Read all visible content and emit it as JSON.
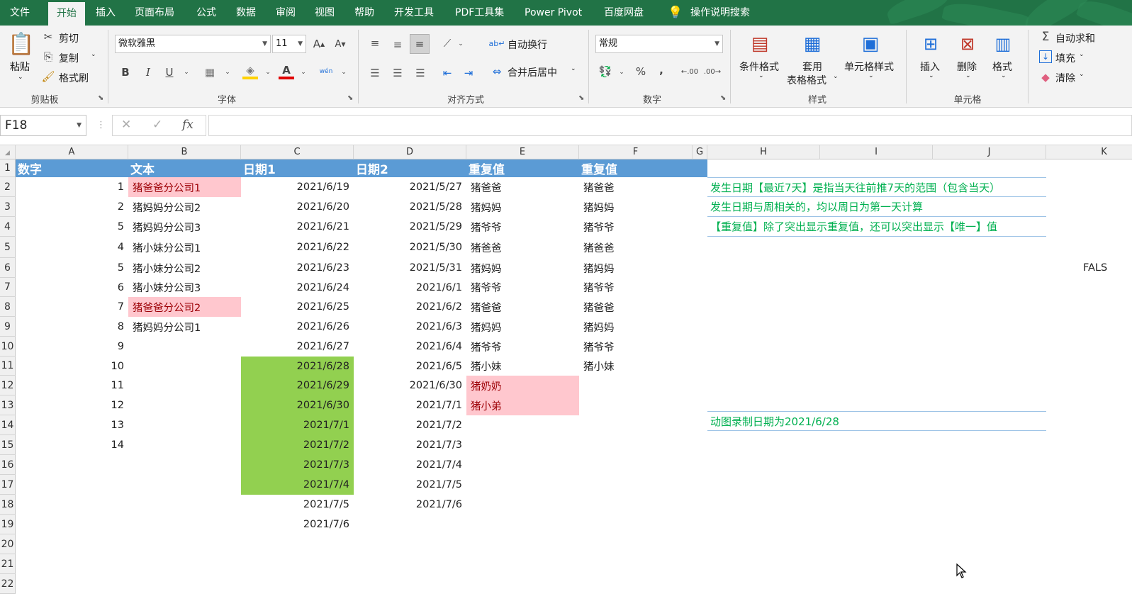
{
  "tabs": [
    "文件",
    "开始",
    "插入",
    "页面布局",
    "公式",
    "数据",
    "审阅",
    "视图",
    "帮助",
    "开发工具",
    "PDF工具集",
    "Power Pivot",
    "百度网盘",
    "操作说明搜索"
  ],
  "ribbon": {
    "clipboard": {
      "paste": "粘贴",
      "cut": "剪切",
      "copy": "复制",
      "format_painter": "格式刷",
      "group": "剪贴板"
    },
    "font": {
      "name": "微软雅黑",
      "size": "11",
      "bold": "B",
      "italic": "I",
      "underline": "U",
      "font_color_glyph": "A",
      "wen": "wén",
      "group": "字体"
    },
    "align": {
      "wrap": "自动换行",
      "merge": "合并后居中",
      "group": "对齐方式"
    },
    "number": {
      "format": "常规",
      "percent": "%",
      "comma": ",",
      "group": "数字"
    },
    "styles": {
      "conditional": "条件格式",
      "table1": "套用",
      "table2": "表格格式",
      "cell_styles": "单元格样式",
      "group": "样式"
    },
    "cells": {
      "insert": "插入",
      "delete": "删除",
      "format": "格式",
      "group": "单元格"
    },
    "editing": {
      "autosum": "自动求和",
      "fill": "填充",
      "clear": "清除"
    }
  },
  "formula_bar": {
    "name_box": "F18",
    "fx": "fx",
    "formula": ""
  },
  "columns": [
    "A",
    "B",
    "C",
    "D",
    "E",
    "F",
    "G",
    "H",
    "I",
    "J",
    "K"
  ],
  "rows": [
    "1",
    "2",
    "3",
    "4",
    "5",
    "6",
    "7",
    "8",
    "9",
    "10",
    "11",
    "12",
    "13",
    "14",
    "15",
    "16",
    "17",
    "18",
    "19",
    "20",
    "21",
    "22"
  ],
  "headers": [
    "数字",
    "文本",
    "日期1",
    "日期2",
    "重复值",
    "重复值"
  ],
  "colA": [
    "1",
    "2",
    "5",
    "4",
    "5",
    "6",
    "7",
    "8",
    "9",
    "10",
    "11",
    "12",
    "13",
    "14"
  ],
  "colB": [
    "猪爸爸分公司1",
    "猪妈妈分公司2",
    "猪妈妈分公司3",
    "猪小妹分公司1",
    "猪小妹分公司2",
    "猪小妹分公司3",
    "猪爸爸分公司2",
    "猪妈妈分公司1"
  ],
  "colC": [
    "2021/6/19",
    "2021/6/20",
    "2021/6/21",
    "2021/6/22",
    "2021/6/23",
    "2021/6/24",
    "2021/6/25",
    "2021/6/26",
    "2021/6/27",
    "2021/6/28",
    "2021/6/29",
    "2021/6/30",
    "2021/7/1",
    "2021/7/2",
    "2021/7/3",
    "2021/7/4",
    "2021/7/5",
    "2021/7/6"
  ],
  "colD": [
    "2021/5/27",
    "2021/5/28",
    "2021/5/29",
    "2021/5/30",
    "2021/5/31",
    "2021/6/1",
    "2021/6/2",
    "2021/6/3",
    "2021/6/4",
    "2021/6/5",
    "2021/6/30",
    "2021/7/1",
    "2021/7/2",
    "2021/7/3",
    "2021/7/4",
    "2021/7/5",
    "2021/7/6"
  ],
  "colE": [
    "猪爸爸",
    "猪妈妈",
    "猪爷爷",
    "猪爸爸",
    "猪妈妈",
    "猪爷爷",
    "猪爸爸",
    "猪妈妈",
    "猪爷爷",
    "猪小妹",
    "猪奶奶",
    "猪小弟"
  ],
  "colF": [
    "猪爸爸",
    "猪妈妈",
    "猪爷爷",
    "猪爸爸",
    "猪妈妈",
    "猪爷爷",
    "猪爸爸",
    "猪妈妈",
    "猪爷爷",
    "猪小妹"
  ],
  "K6": "FALS",
  "notes": [
    "发生日期【最近7天】是指当天往前推7天的范围（包含当天）",
    "发生日期与周相关的，均以周日为第一天计算",
    "【重复值】除了突出显示重复值，还可以突出显示【唯一】值"
  ],
  "note2": "动图录制日期为2021/6/28",
  "colors": {
    "excel_green": "#217346",
    "header_blue": "#5b9bd5",
    "highlight_pink": "#ffc7ce",
    "highlight_green": "#92d050",
    "note_green": "#00b050"
  }
}
